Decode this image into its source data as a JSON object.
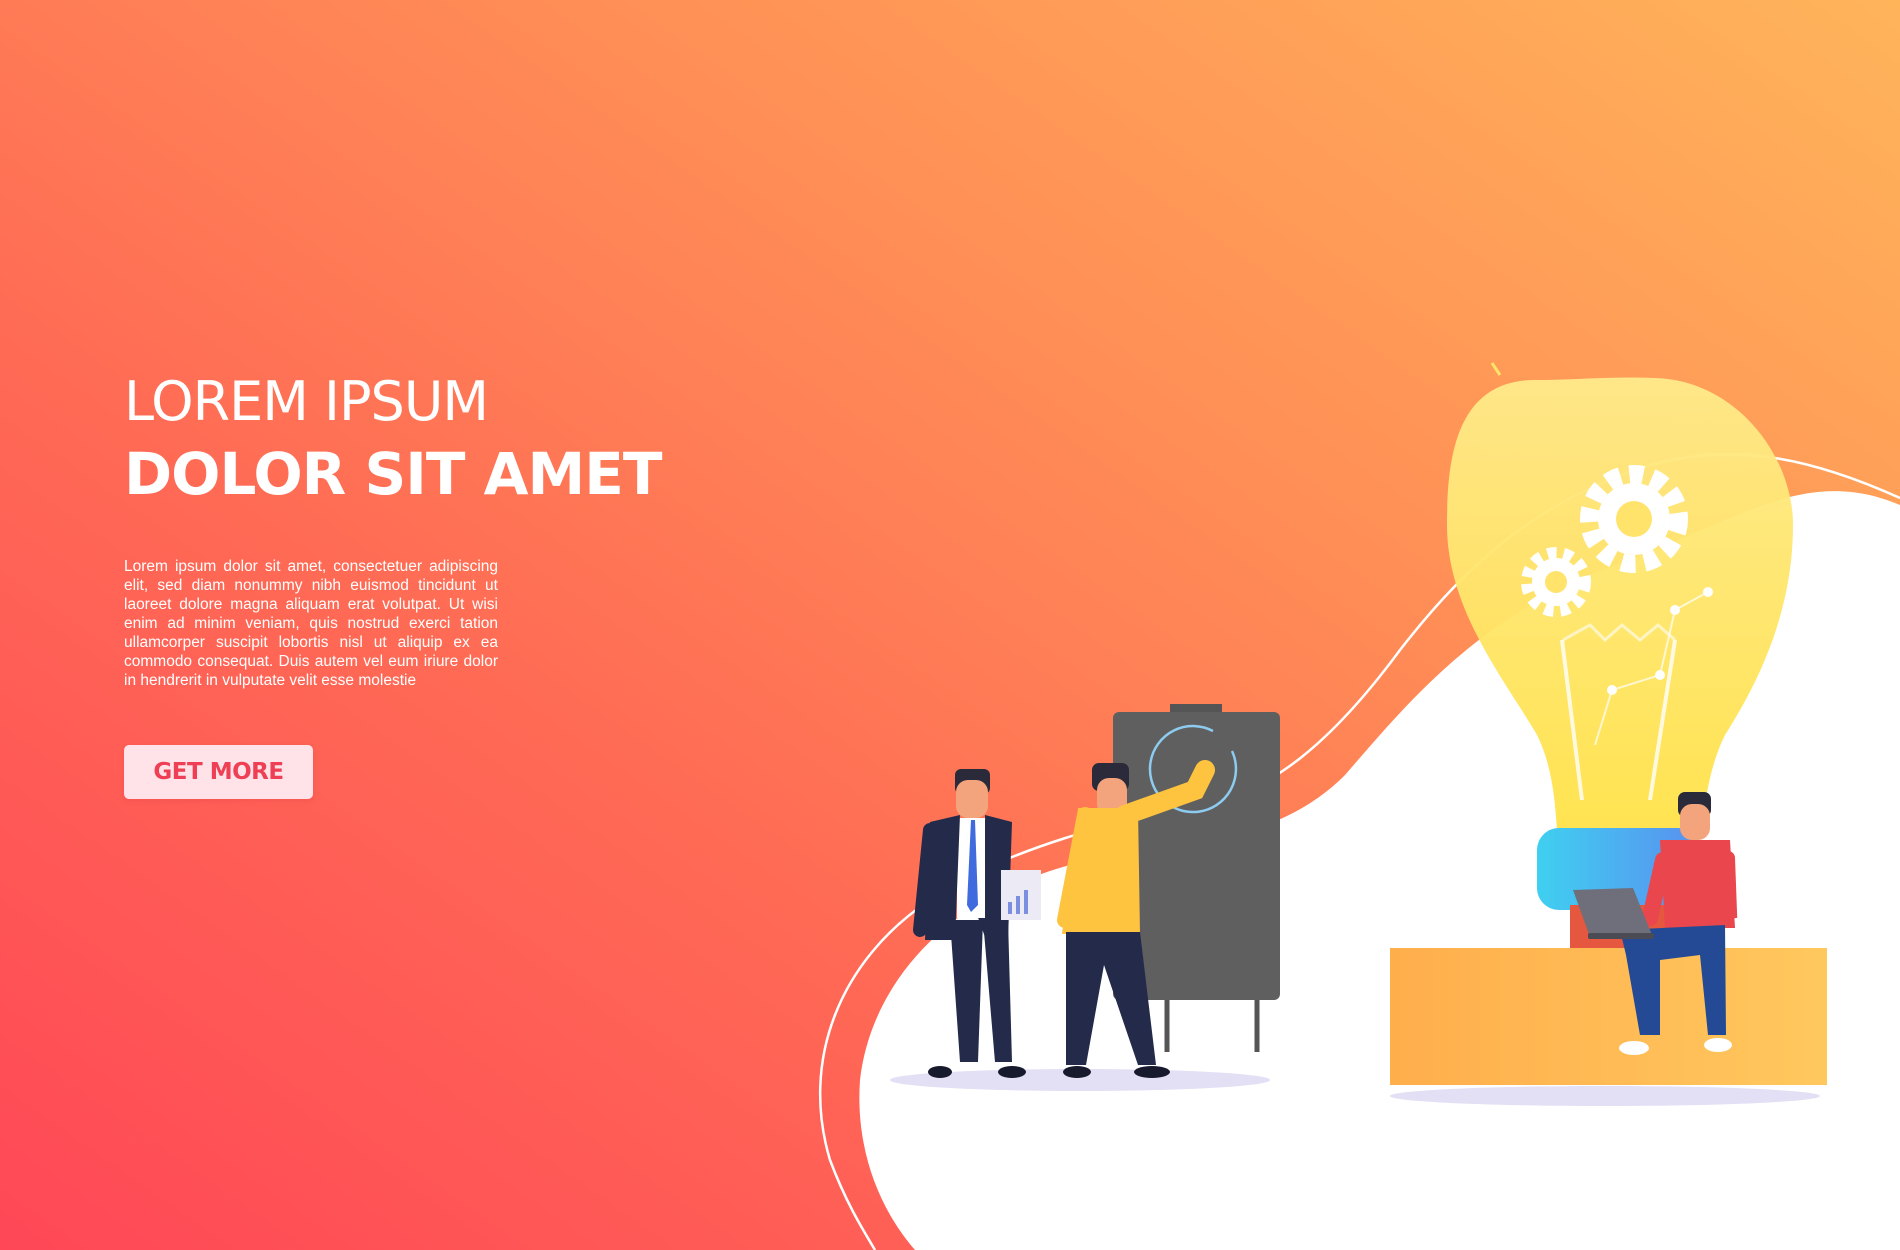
{
  "hero": {
    "headline_light": "LOREM IPSUM",
    "headline_bold": "DOLOR SIT AMET",
    "body": "Lorem ipsum dolor sit amet, consectetuer adipiscing elit, sed diam nonummy nibh euismod tincidunt ut laoreet dolore magna aliquam erat volutpat. Ut wisi enim ad minim veniam, quis nostrud exerci tation ullamcorper suscipit lobortis nisl ut aliquip ex ea commodo consequat. Duis autem vel eum iriure dolor in hendrerit in vulputate velit esse molestie",
    "cta_label": "GET MORE"
  },
  "colors": {
    "gradient_start": "#ff4757",
    "gradient_end": "#ffb45a",
    "button_bg": "#ffe3e8",
    "button_text": "#ee3f55",
    "bulb_yellow": "#ffe36a",
    "bulb_base": "#3ec6ee",
    "board": "#5f5f5f",
    "block": "#fdb95a"
  },
  "illustration": {
    "icons": [
      "lightbulb-icon",
      "gear-icon",
      "flipchart-board",
      "laptop-icon"
    ]
  }
}
